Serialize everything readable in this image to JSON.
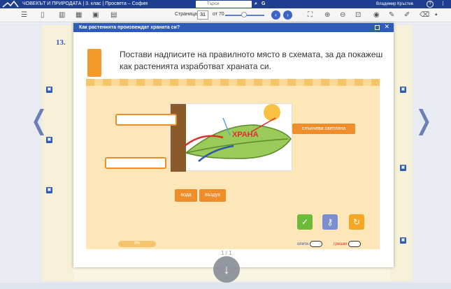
{
  "titlebar": {
    "title": "ЧОВЕКЪТ И ПРИРОДАТА | 3. клас | Просвета – София",
    "search_placeholder": "Търси",
    "user": "Владимир Кръстев"
  },
  "toolbar": {
    "page_label": "Страница",
    "page_value": "31",
    "page_of": "от 70"
  },
  "book": {
    "page_number": "13."
  },
  "dialog": {
    "title": "Как растенията произвеждат храната си?",
    "instruction": "Постави надписите на правилното място в схемата, за да покажеш как растенията изработват храната си.",
    "leaf_word": "ХРАНА",
    "sun_label": "слънчева светлина",
    "chips": [
      "вода",
      "въздух"
    ],
    "progress": "0%",
    "toggle_attempts": "опити",
    "toggle_errors": "грешки",
    "pager": "1 / 1"
  },
  "colors": {
    "header": "#1e3f8f",
    "accent": "#2f5bb8",
    "orange": "#f08d2b",
    "check": "#6dbb3b",
    "key": "#7b8fd0",
    "retry": "#f5a623"
  },
  "icons": [
    "menu-icon",
    "layout-icon",
    "image-icon",
    "fullscreen-icon",
    "zoom-in-icon",
    "zoom-out-icon",
    "fit-icon",
    "eye-icon",
    "pen-icon",
    "eraser-icon",
    "save-icon",
    "check-icon",
    "key-icon",
    "retry-icon",
    "scroll-down-icon"
  ]
}
